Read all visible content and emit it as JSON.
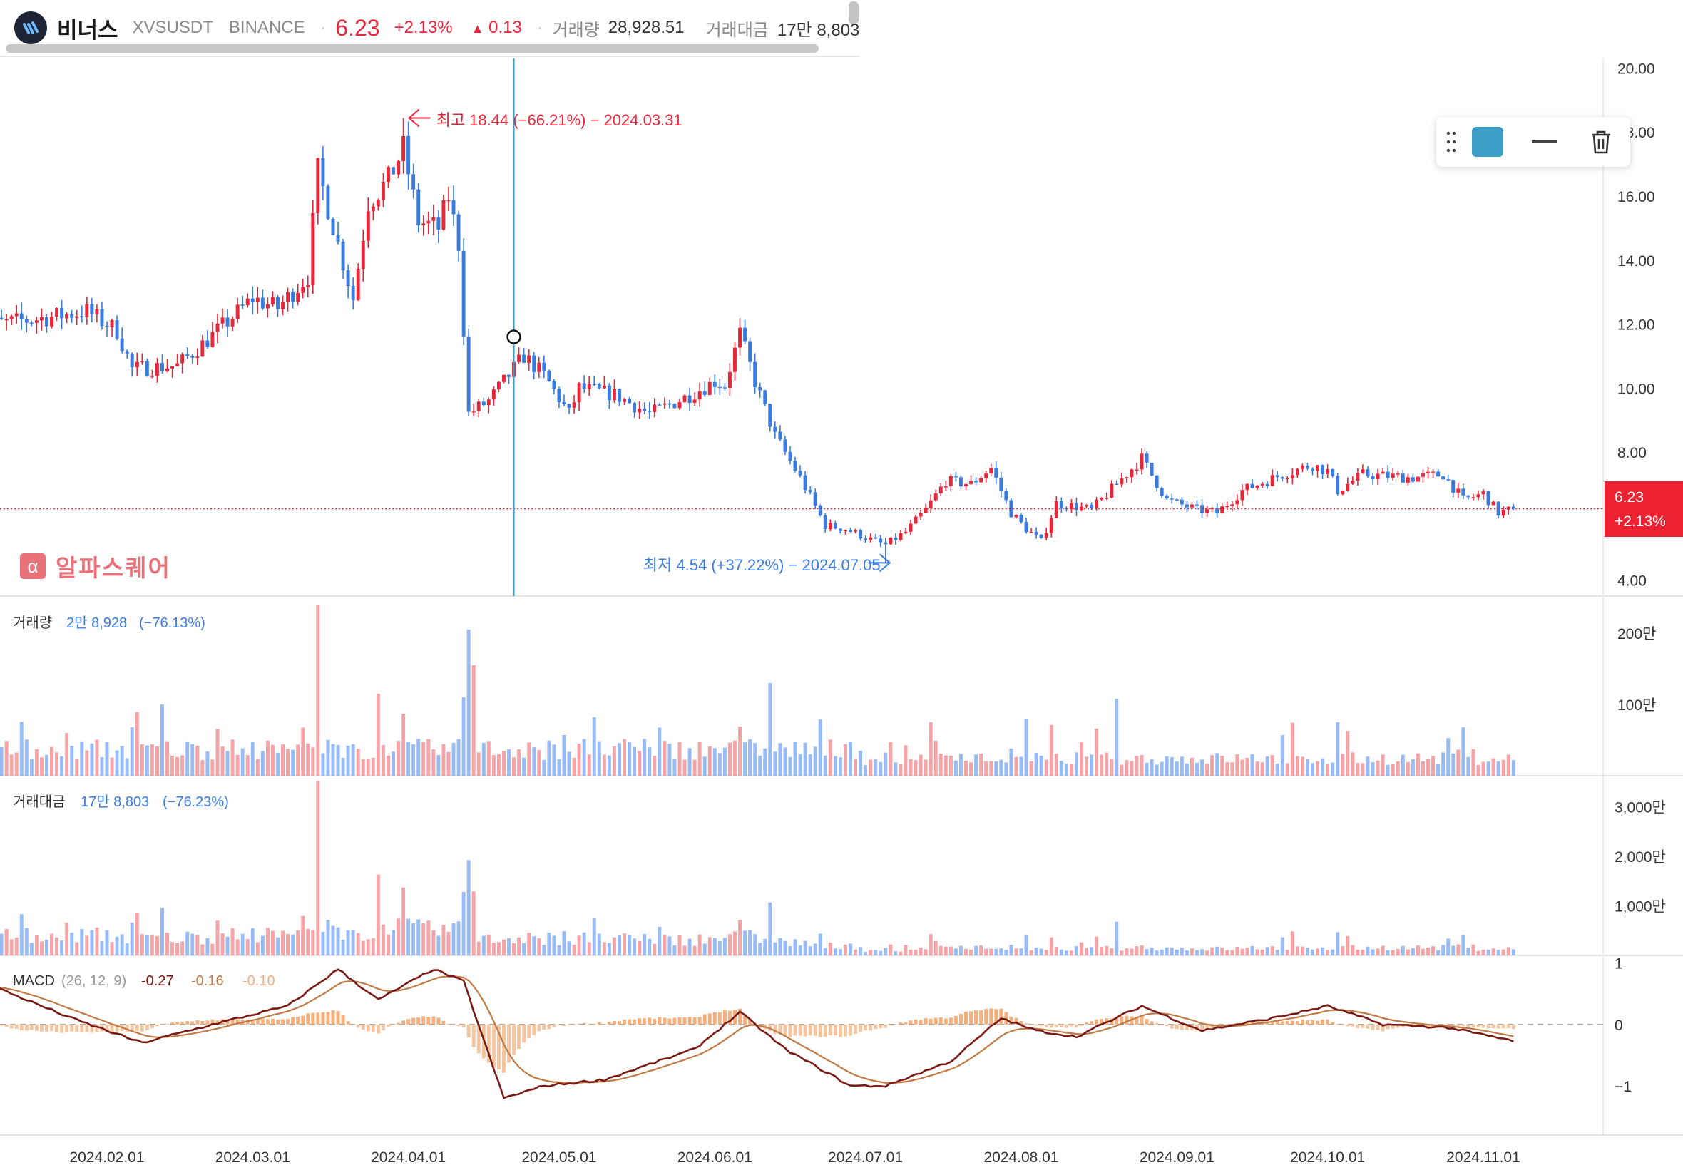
{
  "header": {
    "name": "비너스",
    "symbol": "XVSUSDT",
    "exchange": "BINANCE",
    "price": "6.23",
    "change_pct": "+2.13%",
    "change_abs": "0.13",
    "volume_label": "거래량",
    "volume_value": "28,928.51",
    "turnover_label": "거래대금",
    "turnover_value": "17만 8,803"
  },
  "toolbar": {
    "color": "#3d9ec7",
    "icons": [
      "grip-icon",
      "line-style-icon",
      "trash-icon"
    ]
  },
  "watermark": {
    "text": "알파스퀘어",
    "icon": "α"
  },
  "price_tag": {
    "price": "6.23",
    "pct": "+2.13%"
  },
  "annotations": {
    "high": "최고 18.44 (−66.21%) − 2024.03.31",
    "low": "최저 4.54 (+37.22%) − 2024.07.05"
  },
  "panels": {
    "volume": {
      "label": "거래량",
      "value": "2만 8,928",
      "pct": "(−76.13%)"
    },
    "turnover": {
      "label": "거래대금",
      "value": "17만 8,803",
      "pct": "(−76.23%)"
    },
    "macd": {
      "label": "MACD",
      "params": "(26, 12, 9)",
      "v1": "-0.27",
      "v2": "-0.16",
      "v3": "-0.10"
    }
  },
  "colors": {
    "up": "#e8263b",
    "down": "#3a7be0",
    "vol_up": "#f5a3a6",
    "vol_down": "#99bbf5",
    "macd_line": "#7a1a14",
    "signal_line": "#c07a45",
    "hist": "#f4bf96"
  },
  "chart_data": {
    "type": "candlestick",
    "x_ticks": [
      "2024.02.01",
      "2024.03.01",
      "2024.04.01",
      "2024.05.01",
      "2024.06.01",
      "2024.07.01",
      "2024.08.01",
      "2024.09.01",
      "2024.10.01",
      "2024.11.01"
    ],
    "price_axis": {
      "ticks": [
        "20.00",
        "18.00",
        "16.00",
        "14.00",
        "12.00",
        "10.00",
        "8.00",
        "6.00",
        "4.00"
      ],
      "range": [
        3.5,
        20.3
      ]
    },
    "volume_axis": {
      "ticks": [
        "200만",
        "100만"
      ],
      "range": [
        0,
        2500000
      ]
    },
    "turnover_axis": {
      "ticks": [
        "3,000만",
        "2,000만",
        "1,000만"
      ],
      "range": [
        0,
        36000000
      ]
    },
    "macd_axis": {
      "ticks": [
        "1",
        "0",
        "-1"
      ],
      "range": [
        -1.8,
        1.1
      ]
    },
    "close_anchors": [
      [
        "2024.01.10",
        12.0
      ],
      [
        "2024.01.20",
        12.2
      ],
      [
        "2024.01.28",
        12.4
      ],
      [
        "2024.02.03",
        11.8
      ],
      [
        "2024.02.06",
        10.6
      ],
      [
        "2024.02.15",
        10.7
      ],
      [
        "2024.02.21",
        11.5
      ],
      [
        "2024.03.01",
        12.8
      ],
      [
        "2024.03.06",
        12.5
      ],
      [
        "2024.03.12",
        13.5
      ],
      [
        "2024.03.14",
        16.8
      ],
      [
        "2024.03.18",
        14.5
      ],
      [
        "2024.03.21",
        12.8
      ],
      [
        "2024.03.24",
        15.8
      ],
      [
        "2024.03.28",
        16.5
      ],
      [
        "2024.03.31",
        17.5
      ],
      [
        "2024.04.03",
        15.2
      ],
      [
        "2024.04.07",
        15.0
      ],
      [
        "2024.04.09",
        16.0
      ],
      [
        "2024.04.11",
        14.5
      ],
      [
        "2024.04.13",
        9.2
      ],
      [
        "2024.04.17",
        9.6
      ],
      [
        "2024.04.24",
        11.0
      ],
      [
        "2024.04.28",
        10.4
      ],
      [
        "2024.05.03",
        9.2
      ],
      [
        "2024.05.05",
        10.0
      ],
      [
        "2024.05.12",
        9.8
      ],
      [
        "2024.05.19",
        9.2
      ],
      [
        "2024.05.26",
        9.7
      ],
      [
        "2024.06.01",
        10.2
      ],
      [
        "2024.06.03",
        10.1
      ],
      [
        "2024.06.06",
        11.7
      ],
      [
        "2024.06.09",
        10.2
      ],
      [
        "2024.06.13",
        8.5
      ],
      [
        "2024.06.18",
        7.2
      ],
      [
        "2024.06.23",
        5.7
      ],
      [
        "2024.06.27",
        5.6
      ],
      [
        "2024.07.03",
        5.2
      ],
      [
        "2024.07.05",
        5.1
      ],
      [
        "2024.07.09",
        5.5
      ],
      [
        "2024.07.13",
        6.2
      ],
      [
        "2024.07.17",
        7.1
      ],
      [
        "2024.07.22",
        7.0
      ],
      [
        "2024.07.26",
        7.5
      ],
      [
        "2024.07.30",
        6.1
      ],
      [
        "2024.08.02",
        5.6
      ],
      [
        "2024.08.05",
        5.2
      ],
      [
        "2024.08.08",
        6.4
      ],
      [
        "2024.08.15",
        6.2
      ],
      [
        "2024.08.20",
        7.0
      ],
      [
        "2024.08.25",
        7.8
      ],
      [
        "2024.08.30",
        6.5
      ],
      [
        "2024.09.05",
        6.2
      ],
      [
        "2024.09.09",
        6.1
      ],
      [
        "2024.09.14",
        6.8
      ],
      [
        "2024.09.22",
        7.3
      ],
      [
        "2024.09.28",
        7.6
      ],
      [
        "2024.10.01",
        7.4
      ],
      [
        "2024.10.03",
        6.8
      ],
      [
        "2024.10.08",
        7.3
      ],
      [
        "2024.10.18",
        7.2
      ],
      [
        "2024.10.24",
        7.3
      ],
      [
        "2024.10.28",
        6.5
      ],
      [
        "2024.11.01",
        6.7
      ],
      [
        "2024.11.04",
        6.1
      ],
      [
        "2024.11.07",
        6.23
      ]
    ],
    "high": {
      "date": "2024.03.31",
      "value": 18.44
    },
    "low": {
      "date": "2024.07.05",
      "value": 4.54
    },
    "last": 6.23,
    "macd_anchors": [
      [
        "2024.01.10",
        0.6
      ],
      [
        "2024.01.25",
        0.1
      ],
      [
        "2024.02.08",
        -0.3
      ],
      [
        "2024.02.22",
        0.0
      ],
      [
        "2024.03.08",
        0.3
      ],
      [
        "2024.03.18",
        0.9
      ],
      [
        "2024.03.26",
        0.4
      ],
      [
        "2024.04.06",
        0.9
      ],
      [
        "2024.04.12",
        0.7
      ],
      [
        "2024.04.20",
        -1.2
      ],
      [
        "2024.04.28",
        -1.0
      ],
      [
        "2024.05.10",
        -0.9
      ],
      [
        "2024.05.28",
        -0.4
      ],
      [
        "2024.06.06",
        0.2
      ],
      [
        "2024.06.15",
        -0.4
      ],
      [
        "2024.06.28",
        -1.0
      ],
      [
        "2024.07.05",
        -1.0
      ],
      [
        "2024.07.18",
        -0.6
      ],
      [
        "2024.07.28",
        0.1
      ],
      [
        "2024.08.04",
        -0.1
      ],
      [
        "2024.08.12",
        -0.2
      ],
      [
        "2024.08.25",
        0.3
      ],
      [
        "2024.09.06",
        -0.1
      ],
      [
        "2024.09.20",
        0.1
      ],
      [
        "2024.10.01",
        0.3
      ],
      [
        "2024.10.12",
        0.0
      ],
      [
        "2024.10.25",
        -0.05
      ],
      [
        "2024.11.07",
        -0.27
      ]
    ]
  }
}
